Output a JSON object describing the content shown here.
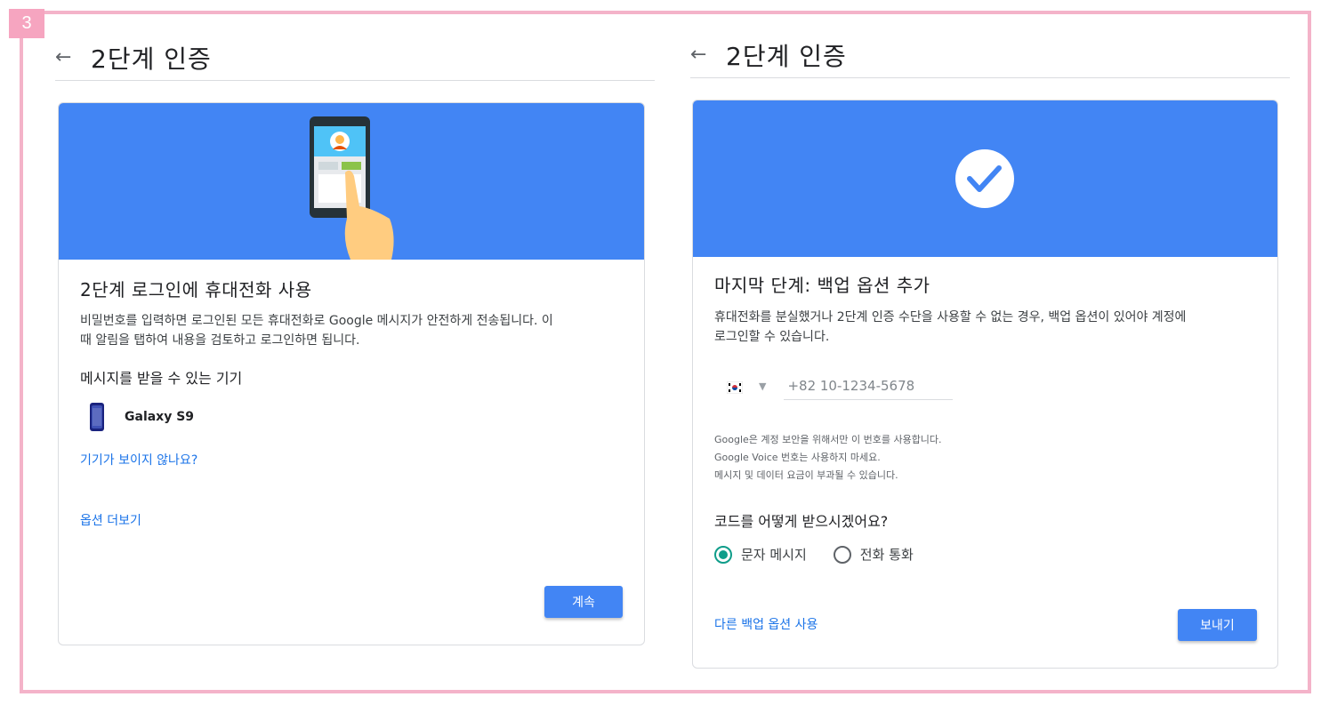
{
  "step_badge": "3",
  "left_panel": {
    "header": {
      "back_icon": "arrow-back-icon",
      "title": "2단계 인증"
    },
    "card": {
      "title": "2단계 로그인에 휴대전화 사용",
      "description_line1": "비밀번호를 입력하면 로그인된 모든 휴대전화로 Google 메시지가 안전하게 전송됩니다. 이",
      "description_line2": "때 알림을 탭하여 내용을 검토하고 로그인하면 됩니다.",
      "devices_heading": "메시지를 받을 수 있는 기기",
      "device": {
        "icon": "smartphone-icon",
        "name": "Galaxy S9"
      },
      "no_device_link": "기기가 보이지 않나요?",
      "more_options_link": "옵션 더보기",
      "continue_button": "계속"
    }
  },
  "right_panel": {
    "header": {
      "back_icon": "arrow-back-icon",
      "title": "2단계 인증"
    },
    "card": {
      "title": "마지막 단계: 백업 옵션 추가",
      "description_line1": "휴대전화를 분실했거나 2단계 인증 수단을 사용할 수 없는 경우, 백업 옵션이 있어야 계정에",
      "description_line2": "로그인할 수 있습니다.",
      "country_flag": "south-korea-flag-icon",
      "phone_placeholder": "+82 10-1234-5678",
      "notes": [
        "Google은 계정 보안을 위해서만 이 번호를 사용합니다.",
        "Google Voice 번호는 사용하지 마세요.",
        "메시지 및 데이터 요금이 부과될 수 있습니다."
      ],
      "code_question": "코드를 어떻게 받으시겠어요?",
      "options": [
        {
          "label": "문자 메시지",
          "selected": true
        },
        {
          "label": "전화 통화",
          "selected": false
        }
      ],
      "other_backup_link": "다른 백업 옵션 사용",
      "send_button": "보내기"
    }
  },
  "colors": {
    "banner": "#4285f4",
    "frame": "#f4b3c9",
    "link": "#1a73e8",
    "radio_selected": "#0f9d8a"
  }
}
